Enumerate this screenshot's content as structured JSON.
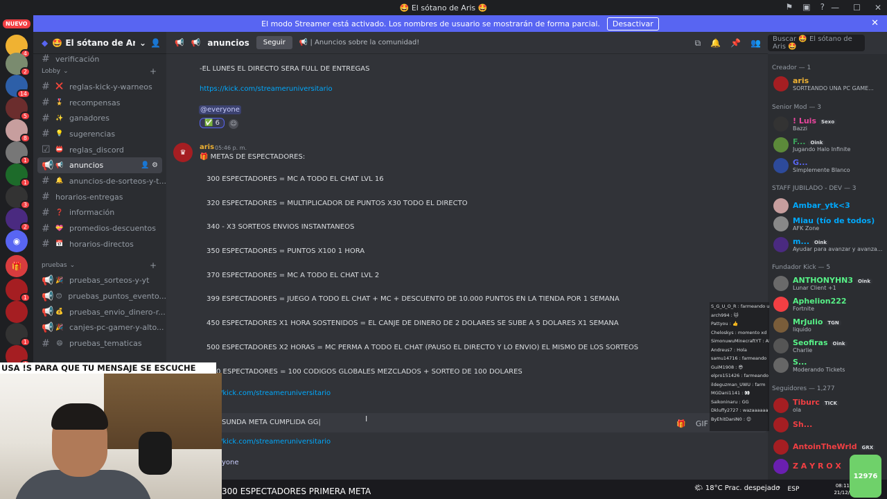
{
  "window": {
    "title": "🤩 El sótano de Aris 🤩"
  },
  "banner": {
    "text": "El modo Streamer está activado. Los nombres de usuario se mostrarán de forma parcial.",
    "button": "Desactivar"
  },
  "guilds": {
    "nuevo": "NUEVO",
    "badges": [
      "4",
      "2",
      "14",
      "5",
      "8",
      "1",
      "1",
      "3",
      "2",
      "1",
      "1",
      "4"
    ]
  },
  "server": {
    "name": "🤩 El sótano de Aris ...",
    "top_partial": "verificación"
  },
  "categories": {
    "lobby": "Lobby",
    "pruebas": "pruebas"
  },
  "channels_lobby": [
    {
      "emoji": "❌",
      "label": "reglas-kick-y-warneos"
    },
    {
      "emoji": "🎖️",
      "label": "recompensas"
    },
    {
      "emoji": "✨",
      "label": "ganadores"
    },
    {
      "emoji": "💡",
      "label": "sugerencias"
    },
    {
      "emoji": "📛",
      "label": "reglas_discord"
    },
    {
      "emoji": "📢",
      "label": "anuncios"
    },
    {
      "emoji": "🔔",
      "label": "anuncios-de-sorteos-y-t..."
    },
    {
      "emoji": "",
      "label": "horarios-entregas"
    },
    {
      "emoji": "❓",
      "label": "información"
    },
    {
      "emoji": "💝",
      "label": "promedios-descuentos"
    },
    {
      "emoji": "📅",
      "label": "horarios-directos"
    }
  ],
  "channels_pruebas": [
    {
      "emoji": "🎉",
      "label": "pruebas_sorteos-y-yt"
    },
    {
      "emoji": "😊",
      "label": "pruebas_puntos_evento..."
    },
    {
      "emoji": "💰",
      "label": "pruebas_envio_dinero-r..."
    },
    {
      "emoji": "🎉",
      "label": "canjes-pc-gamer-y-alto..."
    },
    {
      "emoji": "😄",
      "label": "pruebas_tematicas"
    }
  ],
  "topbar": {
    "channel": "anuncios",
    "follow": "Seguir",
    "topic": "📢 | Anuncios sobre la comunidad!",
    "search_placeholder": "Buscar 🤩 El sótano de Aris 🤩"
  },
  "prev_message": {
    "line1": "-EL LUNES EL DIRECTO SERA FULL DE ENTREGAS",
    "link": "https://kick.com/streameruniversitario",
    "mention": "@everyone",
    "reaction": "✅ 6"
  },
  "message": {
    "author": "aris",
    "time": "05:46 p. m.",
    "title": "🎁 METAS DE ESPECTADORES:",
    "lines": [
      "300 ESPECTADORES = MC A TODO EL CHAT LVL 16",
      "320 ESPECTADORES = MULTIPLICADOR DE PUNTOS X30 TODO EL DIRECTO",
      "340 - X3 SORTEOS ENVIOS INSTANTANEOS",
      "350 ESPECTADORES = PUNTOS X100 1 HORA",
      "370 ESPECTADORES = MC A TODO EL CHAT LVL 2",
      "399 ESPECTADORES = JUEGO A TODO EL CHAT + MC + DESCUENTO DE 10.000 PUNTOS EN LA TIENDA POR 1 SEMANA",
      "450 ESPECTADORES X1 HORA SOSTENIDOS = EL CANJE DE DINERO DE 2 DOLARES SE SUBE A 5 DOLARES X1 SEMANA",
      "500 ESPECTADORES X2 HORAS = MC PERMA A TODO EL CHAT (PAUSO EL DIRECTO Y LO ENVIO) EL MISMO DE LOS SORTEOS",
      "0 ESPECTADORES = 100 CODIGOS GLOBALES MEZCLADOS + SORTEO DE 100 DOLARES"
    ],
    "link": "/kick.com/streameruniversitario"
  },
  "input": {
    "value": "SUNDA META CUMPLIDA GG|"
  },
  "after_input": {
    "link": "/kick.com/streameruniversitario",
    "partial": "yone"
  },
  "members": {
    "creador": "Creador — 1",
    "senior": "Senior Mod — 3",
    "jubilado": "STAFF JUBILADO - DEV — 3",
    "fundador": "Fundador Kick — 5",
    "seguidores": "Seguidores — 1,277",
    "list": [
      {
        "name": "aris",
        "status": "SORTEANDO UNA PC GAME...",
        "color": "#f0b232"
      },
      {
        "name": "! Luis",
        "status": "Bazzi",
        "tag": "Sexo",
        "color": "#eb459e"
      },
      {
        "name": "F...",
        "status": "Jugando Halo Infinite",
        "tag": "Oink",
        "color": "#3ba55c"
      },
      {
        "name": "G...",
        "status": "Simplemente Blanco",
        "color": "#5865f2"
      },
      {
        "name": "Ambar_ytk<3",
        "status": "",
        "color": "#00a8fc"
      },
      {
        "name": "Miau (tío de todos)",
        "status": "AFK Zone",
        "color": "#00a8fc"
      },
      {
        "name": "m...",
        "status": "Ayudar para avanzar y avanza...",
        "tag": "Oink",
        "color": "#00a8fc"
      },
      {
        "name": "ANTHONYHN3",
        "status": "Lunar Client +1",
        "tag": "Oink",
        "color": "#57f287"
      },
      {
        "name": "Aphelion222",
        "status": "Fortnite",
        "color": "#57f287"
      },
      {
        "name": "MrJulio",
        "status": "liquido",
        "tag": "TGN",
        "color": "#57f287"
      },
      {
        "name": "Seofiras",
        "status": "Charlie",
        "tag": "Oink",
        "color": "#57f287"
      },
      {
        "name": "S...",
        "status": "Moderando Tickets",
        "color": "#57f287"
      },
      {
        "name": "Tiburc",
        "status": "ola",
        "tag": "TICK",
        "color": "#f23f43"
      },
      {
        "name": "Sh...",
        "status": "",
        "color": "#f23f43"
      },
      {
        "name": "AntoinTheWrld",
        "status": "",
        "tag": "GRX",
        "color": "#f23f43"
      },
      {
        "name": "Z A Y R O X",
        "status": "",
        "color": "#f23f43"
      }
    ]
  },
  "kick_chat": [
    "S_G_U_O_R : farmeando uwu",
    "arch994 : 🐱",
    "Pattyou : 👍",
    "Cheloskys : momento xd",
    "SimonuwuMinecraftYT : AFK",
    "Andreus7 : Hola",
    "samu14716 : farmeando",
    "GuiM1908 : 😎",
    "elpro151426 : farmeando para la piedra",
    "ildeguzman_UWU : farm",
    "MGDani1141 : 👀",
    "Saikoninaru : GG",
    "Dkluffy2727 : wazaaaaaa",
    "ByEhitDaniN0 : 😊"
  ],
  "overlay": {
    "top": "USA !S PARA QUE TU MENSAJE SE ESCUCHE",
    "bottom": "300 ESPECTADORES PRIMERA META"
  },
  "taskbar": {
    "weather": "18°C  Prac. despejado",
    "lang": "ESP",
    "time": "08:11",
    "date": "21/12/"
  },
  "sticker": {
    "text": "12976"
  }
}
